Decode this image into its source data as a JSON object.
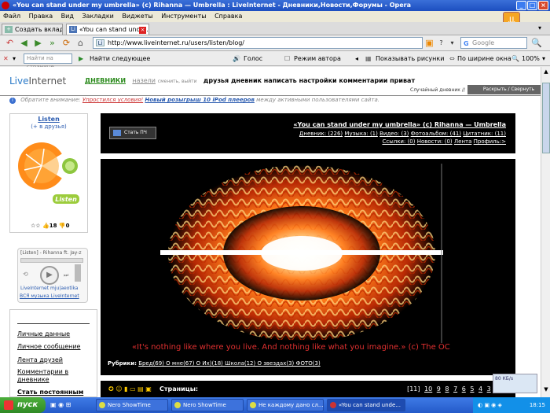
{
  "window": {
    "title": "«You can stand under my umbrella» (c) Rihanna — Umbrella : LiveInternet - Дневники,Новости,Форумы - Opera"
  },
  "menu": [
    "Файл",
    "Правка",
    "Вид",
    "Закладки",
    "Виджеты",
    "Инструменты",
    "Справка"
  ],
  "tabs": {
    "new_tab": "Создать вкладку",
    "active_tab": "«You can stand unde..."
  },
  "address": {
    "url": "http://www.liveinternet.ru/users/listen/blog/",
    "search_placeholder": "Google"
  },
  "findbar": {
    "find_placeholder": "Найти на странице",
    "find_next": "Найти следующее",
    "voice": "Голос",
    "author_mode": "Режим автора",
    "show_images": "Показывать рисунки",
    "fit_width": "По ширине окна",
    "zoom": "100%"
  },
  "site": {
    "logo": "Live",
    "logo2": "Internet",
    "nav_diaries": "ДНЕВНИКИ",
    "nav_nazely": "назели",
    "nav_change": "сменить, выйти",
    "nav_rest": "друзья  дневник  написать  настройки  комментарии  приват",
    "random_diary": "Случайный дневник //",
    "expand": "Раскрыть / Свернуть",
    "notice_prefix": "Обратите внимание:",
    "notice_red": "Упростился условия!",
    "notice_blue": "Новый розыгрыш 10 iPod плееров",
    "notice_suffix": "между активными пользователями сайта."
  },
  "profile": {
    "name": "Listen",
    "friends": "(+ в друзья)",
    "stats": "☆☆ 👍18 👎0"
  },
  "player": {
    "track": "[Listen] - Rihanna ft. Jay-z",
    "footer": "LiveInternet  mju|aeotika",
    "all_music": "ВСЯ музыка LiveInternet"
  },
  "sidebar_links": [
    "Личные данные",
    "Личное сообщение",
    "Лента друзей",
    "Комментарии в",
    "дневнике",
    "Стать постоянным"
  ],
  "header": {
    "become_pch": "Стать ПЧ",
    "title": "«You can stand under my umbrella» (c) Rihanna — Umbrella",
    "line1": {
      "diary": "Дневник: (226)",
      "music": "Музыка: (1)",
      "video": "Видео: (3)",
      "photo": "Фотоальбом: (41)",
      "quotes": "Цитатник: (11)"
    },
    "line2": {
      "links": "Ссылки: (0)",
      "news": "Новости: (0)",
      "feed": "Лента",
      "profile": "Профиль:>"
    }
  },
  "post": {
    "quote": "«It's nothing like where you live. And nothing like what you imagine.» (c) The OC",
    "rubrics_label": "Рубрики:",
    "rubrics": "Бред(69)  О мне(67)  О Их)(18)  Школа(12)  О звездах(3)  ФОТО(3)"
  },
  "pager": {
    "label": "Страницы:",
    "pages": [
      "[11]",
      "10",
      "9",
      "8",
      "7",
      "6",
      "5",
      "4",
      "3",
      "2",
      "1"
    ]
  },
  "net_widget": "80 КБ/s",
  "taskbar": {
    "start": "пуск",
    "items": [
      "Nero ShowTime",
      "Nero ShowTime",
      "Не каждому дано сл...",
      "«You can stand unde..."
    ],
    "clock": "18:15"
  }
}
